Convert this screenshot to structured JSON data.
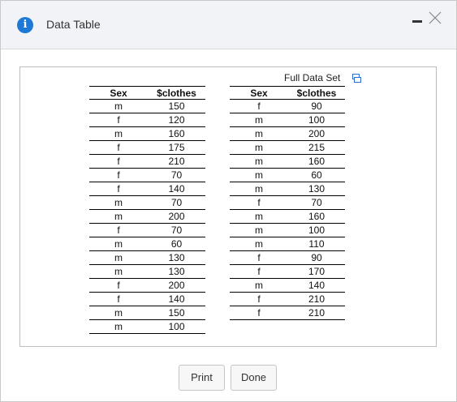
{
  "window": {
    "title": "Data Table",
    "info_icon_glyph": "i",
    "accent_color": "#1e78d6"
  },
  "panel": {
    "full_data_set_label": "Full Data Set"
  },
  "table_left": {
    "headers": [
      "Sex",
      "$clothes"
    ],
    "rows": [
      [
        "m",
        "150"
      ],
      [
        "f",
        "120"
      ],
      [
        "m",
        "160"
      ],
      [
        "f",
        "175"
      ],
      [
        "f",
        "210"
      ],
      [
        "f",
        "70"
      ],
      [
        "f",
        "140"
      ],
      [
        "m",
        "70"
      ],
      [
        "m",
        "200"
      ],
      [
        "f",
        "70"
      ],
      [
        "m",
        "60"
      ],
      [
        "m",
        "130"
      ],
      [
        "m",
        "130"
      ],
      [
        "f",
        "200"
      ],
      [
        "f",
        "140"
      ],
      [
        "m",
        "150"
      ],
      [
        "m",
        "100"
      ]
    ]
  },
  "table_right": {
    "headers": [
      "Sex",
      "$clothes"
    ],
    "rows": [
      [
        "f",
        "90"
      ],
      [
        "m",
        "100"
      ],
      [
        "m",
        "200"
      ],
      [
        "m",
        "215"
      ],
      [
        "m",
        "160"
      ],
      [
        "m",
        "60"
      ],
      [
        "m",
        "130"
      ],
      [
        "f",
        "70"
      ],
      [
        "m",
        "160"
      ],
      [
        "m",
        "100"
      ],
      [
        "m",
        "110"
      ],
      [
        "f",
        "90"
      ],
      [
        "f",
        "170"
      ],
      [
        "m",
        "140"
      ],
      [
        "f",
        "210"
      ],
      [
        "f",
        "210"
      ]
    ]
  },
  "buttons": {
    "print": "Print",
    "done": "Done"
  }
}
